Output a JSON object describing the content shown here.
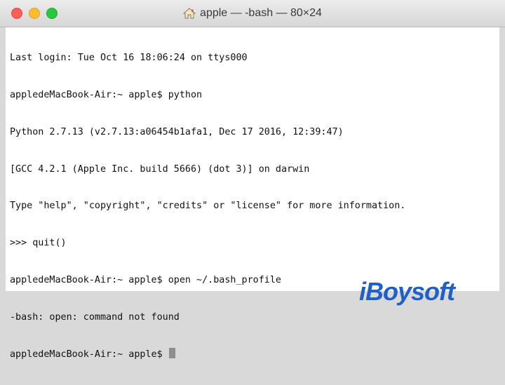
{
  "window": {
    "title": "apple — -bash — 80×24",
    "title_icon": "home-icon",
    "traffic_lights": [
      "close",
      "minimize",
      "zoom"
    ]
  },
  "terminal": {
    "lines": [
      "Last login: Tue Oct 16 18:06:24 on ttys000",
      "appledeMacBook-Air:~ apple$ python",
      "Python 2.7.13 (v2.7.13:a06454b1afa1, Dec 17 2016, 12:39:47)",
      "[GCC 4.2.1 (Apple Inc. build 5666) (dot 3)] on darwin",
      "Type \"help\", \"copyright\", \"credits\" or \"license\" for more information.",
      ">>> quit()",
      "appledeMacBook-Air:~ apple$ open ~/.bash_profile",
      "-bash: open: command not found",
      "appledeMacBook-Air:~ apple$ "
    ]
  },
  "watermark": "iBoysoft",
  "colors": {
    "close": "#fc5f57",
    "minimize": "#fdbc2e",
    "zoom": "#28c840",
    "watermark": "#1f5fc8"
  }
}
